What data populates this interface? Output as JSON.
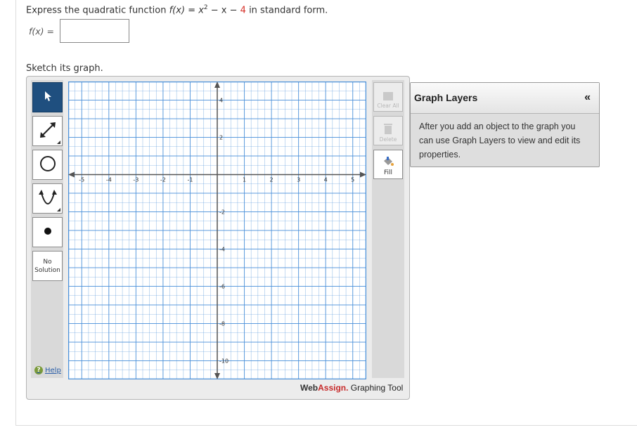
{
  "question": {
    "prefix": "Express the quadratic function ",
    "func_name": "f(x)",
    "equals": " = ",
    "expr_x": "x",
    "expr_exp": "2",
    "expr_middle": " − x − ",
    "expr_const": "4",
    "suffix": " in standard form."
  },
  "answer": {
    "label_name": "f(x)",
    "label_equals": " =",
    "value": ""
  },
  "sketch_prompt": "Sketch its graph.",
  "tools": {
    "no_solution_line1": "No",
    "no_solution_line2": "Solution",
    "help_label": "Help"
  },
  "graph": {
    "x_range": [
      -5.5,
      5.5
    ],
    "y_range": [
      -11,
      5
    ],
    "x_ticks": [
      "-5",
      "-4",
      "-3",
      "-2",
      "-1",
      "1",
      "2",
      "3",
      "4",
      "5"
    ],
    "y_ticks": [
      "4",
      "2",
      "-2",
      "-4",
      "-6",
      "-8",
      "-10"
    ],
    "grid": true,
    "grid_color": "#4a90d9",
    "axis_color": "#555555"
  },
  "side_buttons": {
    "clear_all": "Clear All",
    "delete": "Delete",
    "fill": "Fill"
  },
  "credit": {
    "web": "Web",
    "assign": "Assign.",
    "rest": " Graphing Tool"
  },
  "layers": {
    "title": "Graph Layers",
    "collapse": "«",
    "body": "After you add an object to the graph you can use Graph Layers to view and edit its properties."
  }
}
